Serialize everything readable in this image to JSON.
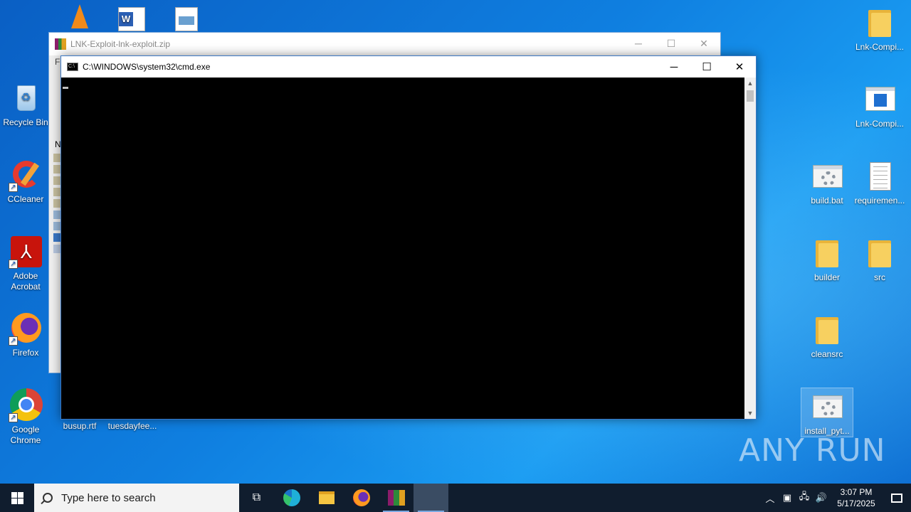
{
  "desktop": {
    "left_icons": [
      {
        "label": "Recycle Bin"
      },
      {
        "label": "CCleaner"
      },
      {
        "label": "Adobe Acrobat"
      },
      {
        "label": "Firefox"
      },
      {
        "label": "Google Chrome"
      }
    ],
    "bottom_icons": [
      {
        "label": "busup.rtf"
      },
      {
        "label": "tuesdayfee..."
      }
    ],
    "right_icons": [
      {
        "label": "Lnk-Compi..."
      },
      {
        "label": "Lnk-Compi..."
      },
      {
        "label": "build.bat"
      },
      {
        "label": "requiremen..."
      },
      {
        "label": "builder"
      },
      {
        "label": "src"
      },
      {
        "label": "cleansrc"
      },
      {
        "label": "install_pyt..."
      }
    ],
    "watermark": "ANY RUN"
  },
  "rar_window": {
    "title": "LNK-Exploit-lnk-exploit.zip",
    "side_letters": [
      "Fi",
      "N"
    ]
  },
  "cmd_window": {
    "title": "C:\\WINDOWS\\system32\\cmd.exe"
  },
  "taskbar": {
    "search_placeholder": "Type here to search",
    "time": "3:07 PM",
    "date": "5/17/2025"
  },
  "colors": {
    "taskbar_bg": "#101d2e",
    "console_bg": "#000000",
    "desktop_blue": "#0f7fe0"
  }
}
